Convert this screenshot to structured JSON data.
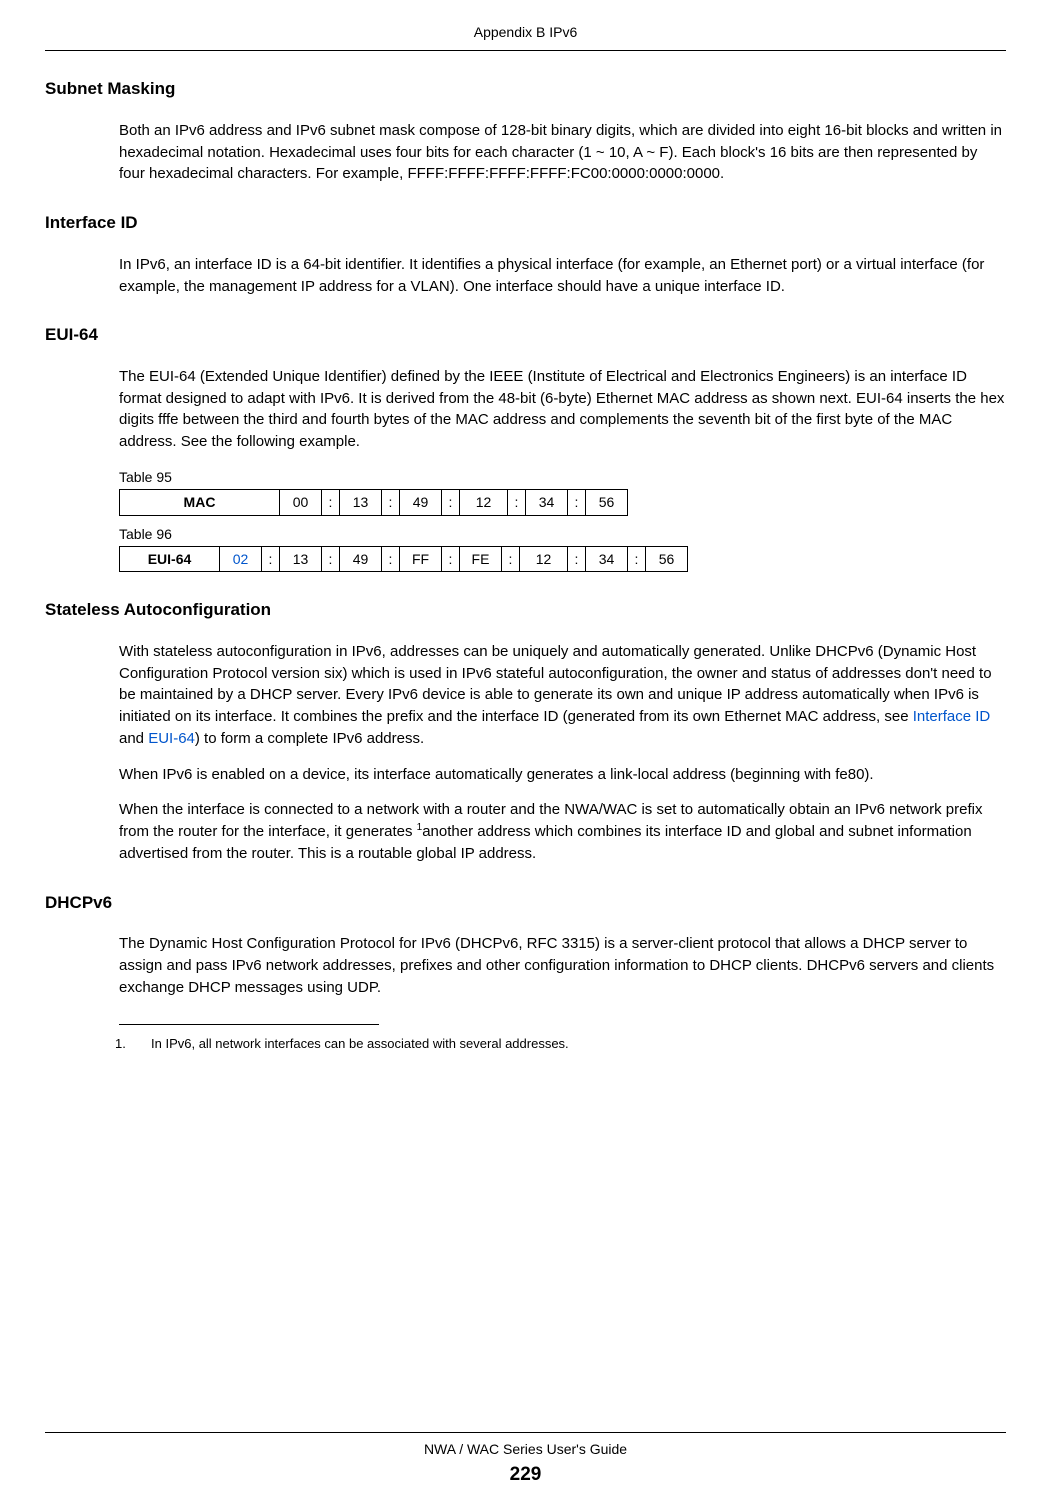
{
  "header": {
    "appendix": "Appendix B IPv6"
  },
  "sections": {
    "subnet_masking": {
      "heading": "Subnet Masking",
      "p1": "Both an IPv6 address and IPv6 subnet mask compose of 128-bit binary digits, which are divided into eight 16-bit blocks and written in hexadecimal notation. Hexadecimal uses four bits for each character (1 ~ 10, A ~ F). Each block's 16 bits are then represented by four hexadecimal characters. For example, FFFF:FFFF:FFFF:FFFF:FC00:0000:0000:0000."
    },
    "interface_id": {
      "heading": "Interface ID",
      "p1": "In IPv6, an interface ID is a 64-bit identifier. It identifies a physical interface (for example, an Ethernet port) or a virtual interface (for example, the management IP address for a VLAN). One interface should have a unique interface ID."
    },
    "eui64": {
      "heading": "EUI-64",
      "p1": "The EUI-64 (Extended Unique Identifier) defined by the IEEE (Institute of Electrical and Electronics Engineers) is an interface ID format designed to adapt with IPv6. It is derived from the 48-bit (6-byte) Ethernet MAC address as shown next. EUI-64 inserts the hex digits fffe between the third and fourth bytes of the MAC address and complements the seventh bit of the first byte of the MAC address. See the following example."
    },
    "stateless": {
      "heading": "Stateless Autoconfiguration",
      "p1_a": "With stateless autoconfiguration in IPv6, addresses can be uniquely and automatically generated. Unlike DHCPv6 (Dynamic Host Configuration Protocol version six) which is used in IPv6 stateful autoconfiguration, the owner and status of addresses don't need to be maintained by a DHCP server. Every IPv6 device is able to generate its own and unique IP address automatically when IPv6 is initiated on its interface. It combines the prefix and the interface ID (generated from its own Ethernet MAC address, see ",
      "link1": "Interface ID",
      "p1_b": " and ",
      "link2": "EUI-64",
      "p1_c": ") to form a complete IPv6 address.",
      "p2": "When IPv6 is enabled on a device, its interface automatically generates a link-local address (beginning with fe80).",
      "p3_a": "When the interface is connected to a network with a router and the NWA/WAC is set to automatically obtain an IPv6 network prefix from the router for the interface, it generates ",
      "sup": "1",
      "p3_b": "another address which combines its interface ID and global and subnet information advertised from the router. This is a routable global IP address."
    },
    "dhcpv6": {
      "heading": "DHCPv6",
      "p1": "The Dynamic Host Configuration Protocol for IPv6 (DHCPv6, RFC 3315) is a server-client protocol that allows a DHCP server to assign and pass IPv6 network addresses, prefixes and other configuration information to DHCP clients. DHCPv6 servers and clients exchange DHCP messages using UDP."
    }
  },
  "tables": {
    "t95": {
      "label": "Table 95",
      "row_label": "MAC",
      "cells": [
        "00",
        ":",
        "13",
        ":",
        "49",
        ":",
        "12",
        ":",
        "34",
        ":",
        "56"
      ]
    },
    "t96": {
      "label": "Table 96",
      "row_label": "EUI-64",
      "cells": [
        "02",
        ":",
        "13",
        ":",
        "49",
        ":",
        "FF",
        ":",
        "FE",
        ":",
        "12",
        ":",
        "34",
        ":",
        "56"
      ]
    }
  },
  "footnote": {
    "num": "1.",
    "text": "In IPv6, all network interfaces can be associated with several addresses."
  },
  "footer": {
    "guide": "NWA / WAC Series User's Guide",
    "page": "229"
  }
}
